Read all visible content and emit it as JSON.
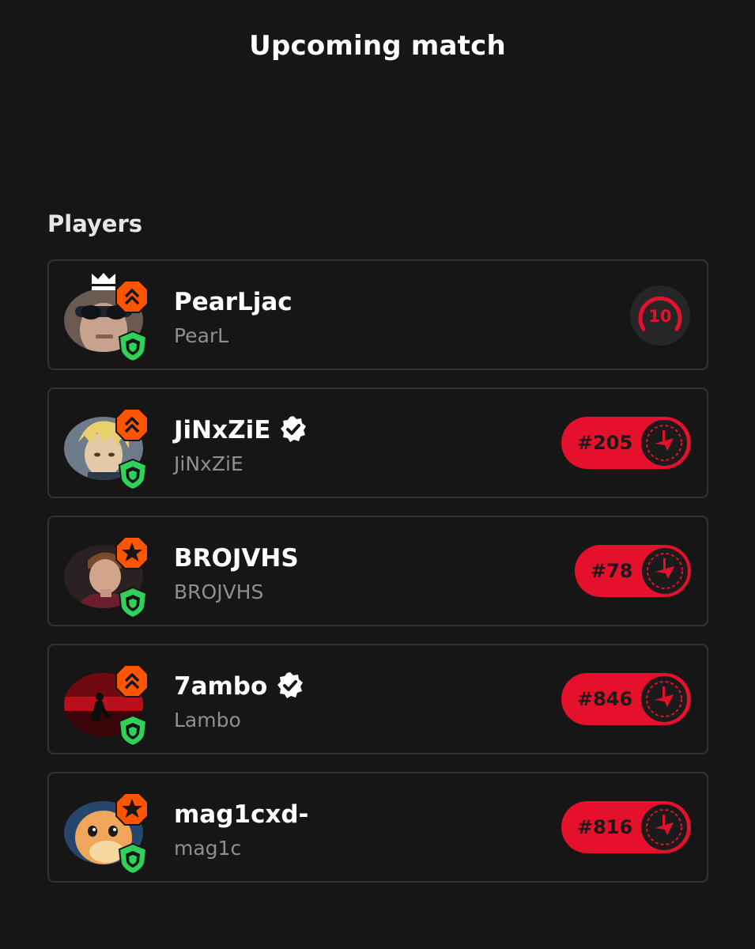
{
  "header": {
    "title": "Upcoming match"
  },
  "players_section": {
    "title": "Players"
  },
  "colors": {
    "background": "#161616",
    "card_border": "#333333",
    "rank_pill": "#e5102c",
    "level_badge": "#ff5500",
    "shield_badge": "#2fd15a"
  },
  "players": [
    {
      "name": "PearLjac",
      "handle": "PearL",
      "verified": false,
      "party_leader": true,
      "level_badge_icon": "chevrons-up-icon",
      "skill_level": "10"
    },
    {
      "name": "JiNxZiE",
      "handle": "JiNxZiE",
      "verified": true,
      "level_badge_icon": "chevrons-up-icon",
      "rank": "#205"
    },
    {
      "name": "BROJVHS",
      "handle": "BROJVHS",
      "verified": false,
      "level_badge_icon": "star-icon",
      "rank": "#78"
    },
    {
      "name": "7ambo",
      "handle": "Lambo",
      "verified": true,
      "level_badge_icon": "chevrons-up-icon",
      "rank": "#846"
    },
    {
      "name": "mag1cxd-",
      "handle": "mag1c",
      "verified": false,
      "level_badge_icon": "star-icon",
      "rank": "#816"
    }
  ]
}
